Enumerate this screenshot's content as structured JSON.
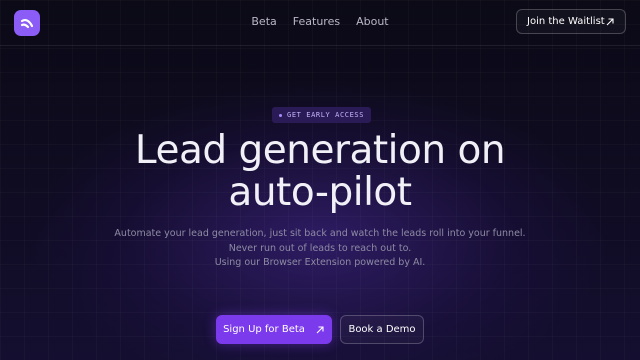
{
  "nav": {
    "links": [
      "Beta",
      "Features",
      "About"
    ],
    "waitlist_label": "Join the Waitlist"
  },
  "hero": {
    "badge": "GET EARLY ACCESS",
    "headline_line1": "Lead generation on",
    "headline_line2": "auto-pilot",
    "subtext": [
      "Automate your lead generation, just sit back and watch the leads roll into your funnel.",
      "Never run out of leads to reach out to.",
      "Using our Browser Extension powered by AI."
    ],
    "primary_cta": "Sign Up for Beta",
    "secondary_cta": "Book a Demo"
  },
  "icons": {
    "logo": "logo-icon",
    "waitlist": "arrow-up-right-icon",
    "primary_cta": "arrow-up-right-icon"
  },
  "colors": {
    "accent": "#7c3aed",
    "logo_bg": "#8b5cf6",
    "background": "#0b0a16",
    "badge_text": "#c4b5fd"
  }
}
